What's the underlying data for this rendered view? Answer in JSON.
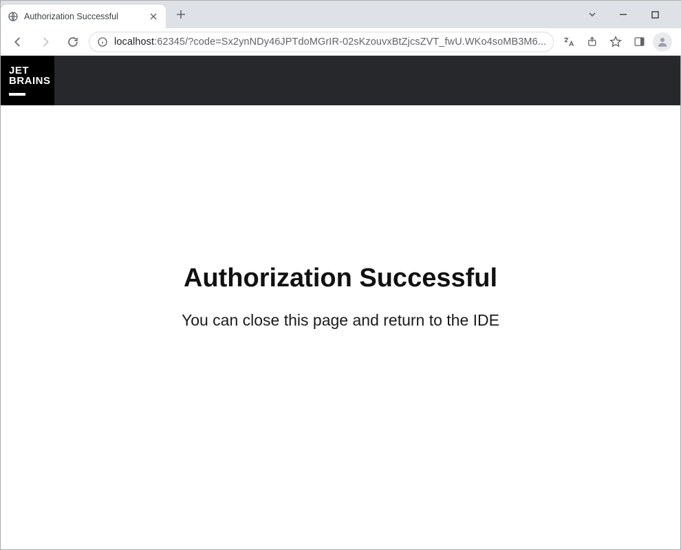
{
  "window": {
    "tab_title": "Authorization Successful"
  },
  "omnibox": {
    "host": "localhost",
    "port": ":62345",
    "path": "/?code=Sx2ynNDy46JPTdoMGrIR-02sKzouvxBtZjcsZVT_fwU.WKo4soMB3M6..."
  },
  "header": {
    "logo_line1": "JET",
    "logo_line2": "BRAINS"
  },
  "content": {
    "heading": "Authorization Successful",
    "subtext": "You can close this page and return to the IDE"
  }
}
